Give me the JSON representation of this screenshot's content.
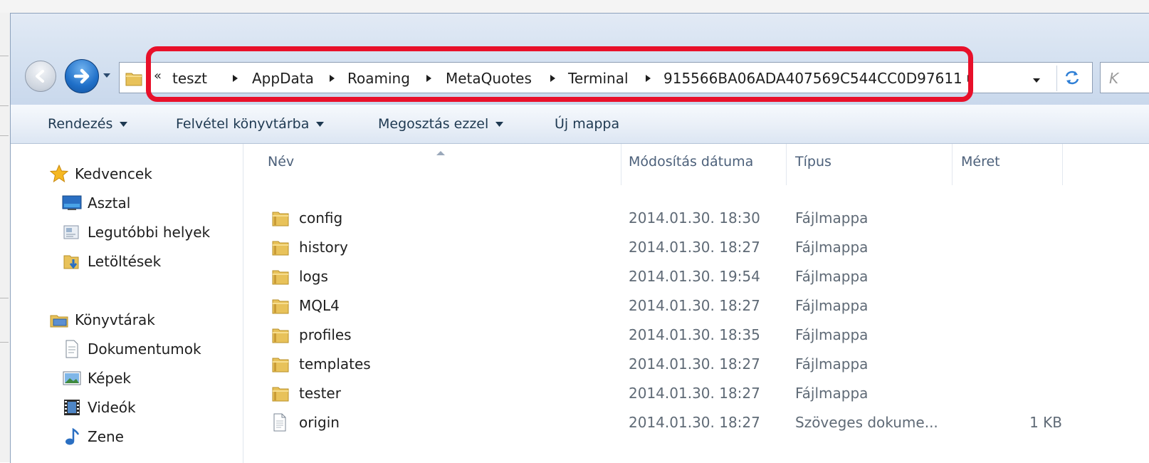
{
  "address": {
    "overflow_glyph": "«",
    "crumbs": [
      "teszt",
      "AppData",
      "Roaming",
      "MetaQuotes",
      "Terminal",
      "915566BA06ADA407569C544CC0D97611"
    ],
    "search_placeholder": "K"
  },
  "toolbar": {
    "organize": "Rendezés",
    "include_library": "Felvétel könyvtárba",
    "share_with": "Megosztás ezzel",
    "new_folder": "Új mappa"
  },
  "navpane": {
    "favorites": "Kedvencek",
    "desktop": "Asztal",
    "recent": "Legutóbbi helyek",
    "downloads": "Letöltések",
    "libraries": "Könyvtárak",
    "documents": "Dokumentumok",
    "pictures": "Képek",
    "videos": "Videók",
    "music": "Zene"
  },
  "columns": {
    "name": "Név",
    "modified": "Módosítás dátuma",
    "type": "Típus",
    "size": "Méret"
  },
  "files": [
    {
      "name": "config",
      "date": "2014.01.30. 18:30",
      "type": "Fájlmappa",
      "size": "",
      "icon": "folder-icon"
    },
    {
      "name": "history",
      "date": "2014.01.30. 18:27",
      "type": "Fájlmappa",
      "size": "",
      "icon": "folder-icon"
    },
    {
      "name": "logs",
      "date": "2014.01.30. 19:54",
      "type": "Fájlmappa",
      "size": "",
      "icon": "folder-icon"
    },
    {
      "name": "MQL4",
      "date": "2014.01.30. 18:27",
      "type": "Fájlmappa",
      "size": "",
      "icon": "folder-icon"
    },
    {
      "name": "profiles",
      "date": "2014.01.30. 18:35",
      "type": "Fájlmappa",
      "size": "",
      "icon": "folder-icon"
    },
    {
      "name": "templates",
      "date": "2014.01.30. 18:27",
      "type": "Fájlmappa",
      "size": "",
      "icon": "folder-icon"
    },
    {
      "name": "tester",
      "date": "2014.01.30. 18:27",
      "type": "Fájlmappa",
      "size": "",
      "icon": "folder-icon"
    },
    {
      "name": "origin",
      "date": "2014.01.30. 18:27",
      "type": "Szöveges dokume...",
      "size": "1 KB",
      "icon": "text-file-icon"
    }
  ],
  "colors": {
    "highlight": "#e8102a",
    "folder": "#e8c25a",
    "toolbar_text": "#1e3951"
  }
}
